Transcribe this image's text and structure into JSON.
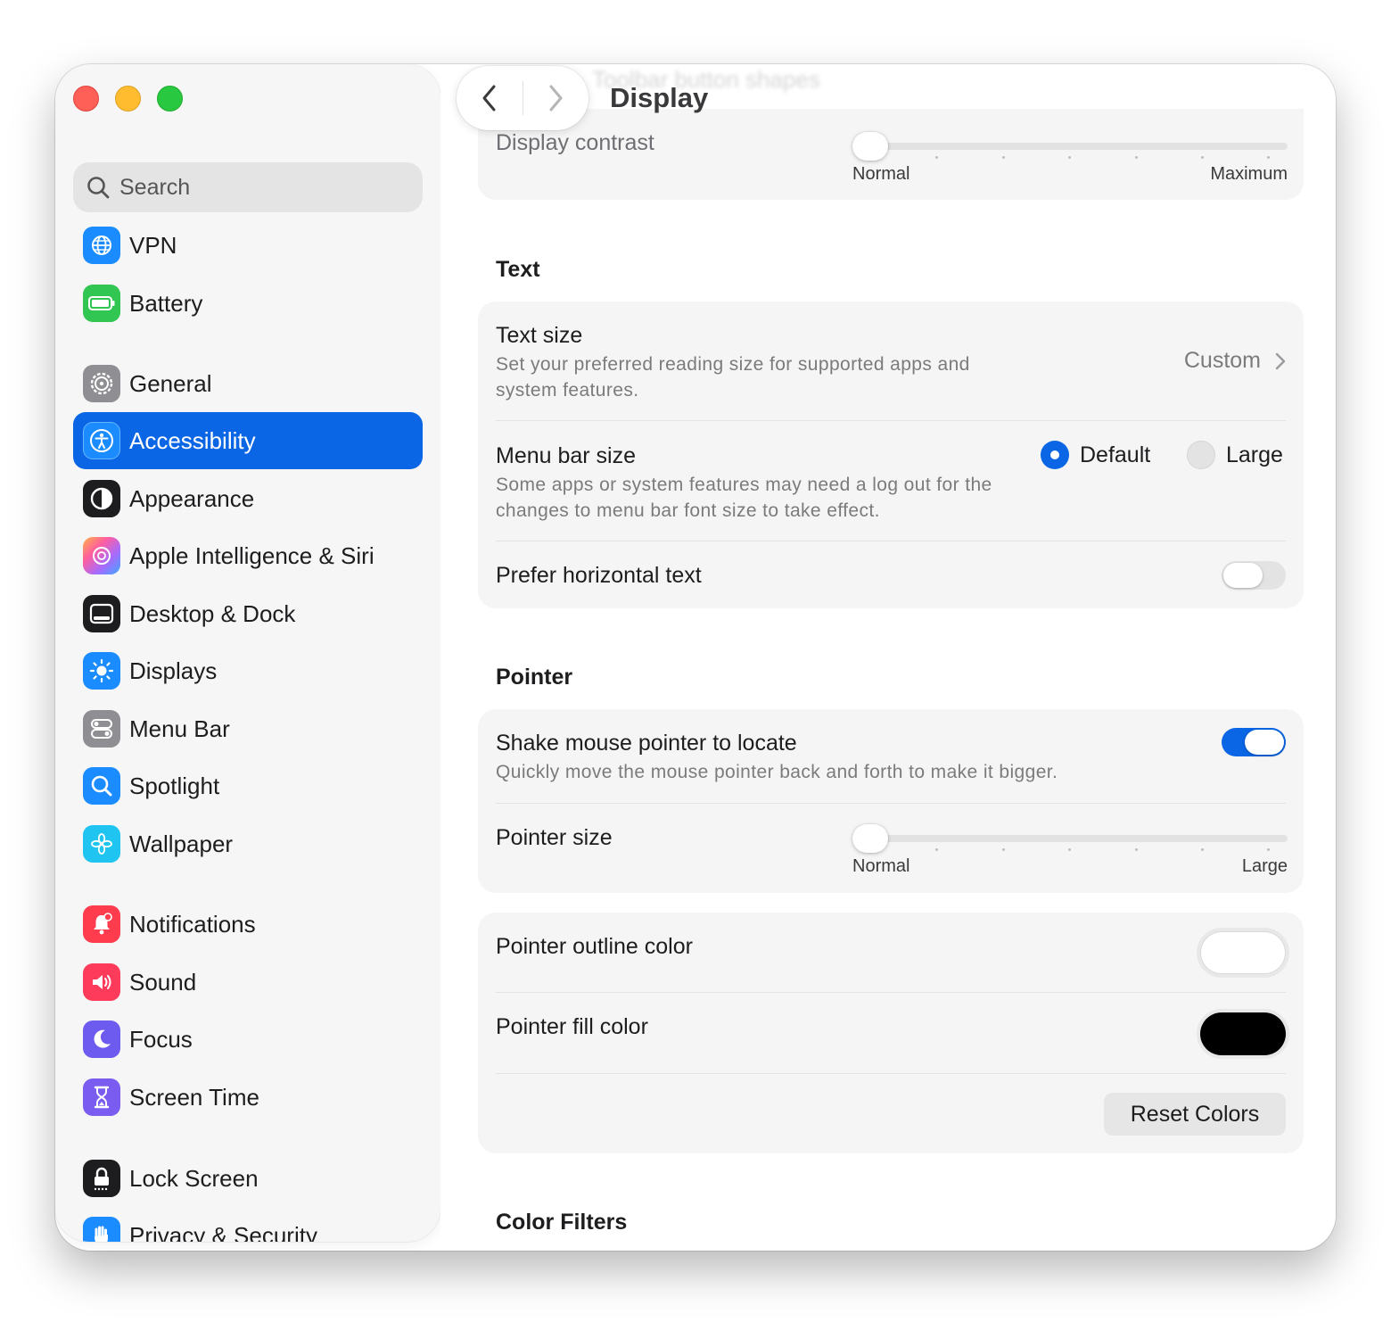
{
  "sidebar": {
    "search_text": "Search",
    "items": [
      {
        "label": "VPN",
        "icon": "vpn-globe-icon",
        "color": "#1a8cff"
      },
      {
        "label": "Battery",
        "icon": "battery-icon",
        "color": "#31c651"
      },
      {
        "label": "General",
        "icon": "gear-icon",
        "color": "#8e8e93"
      },
      {
        "label": "Accessibility",
        "icon": "accessibility-icon",
        "color": "#0a66e4",
        "selected": true
      },
      {
        "label": "Appearance",
        "icon": "appearance-icon",
        "color": "#1d1d1f"
      },
      {
        "label": "Apple Intelligence & Siri",
        "icon": "siri-icon",
        "color": "#ff6aa8"
      },
      {
        "label": "Desktop & Dock",
        "icon": "dock-icon",
        "color": "#1d1d1f"
      },
      {
        "label": "Displays",
        "icon": "sun-icon",
        "color": "#1a8cff"
      },
      {
        "label": "Menu Bar",
        "icon": "menu-bar-icon",
        "color": "#8e8e93"
      },
      {
        "label": "Spotlight",
        "icon": "spotlight-icon",
        "color": "#1a8cff"
      },
      {
        "label": "Wallpaper",
        "icon": "flower-icon",
        "color": "#1fc5f0"
      },
      {
        "label": "Notifications",
        "icon": "bell-icon",
        "color": "#ff3b4e"
      },
      {
        "label": "Sound",
        "icon": "speaker-icon",
        "color": "#ff3b5c"
      },
      {
        "label": "Focus",
        "icon": "moon-icon",
        "color": "#6d5bf0"
      },
      {
        "label": "Screen Time",
        "icon": "hourglass-icon",
        "color": "#7b5cf0"
      },
      {
        "label": "Lock Screen",
        "icon": "lock-icon",
        "color": "#1d1d1f"
      },
      {
        "label": "Privacy & Security",
        "icon": "hand-icon",
        "color": "#1a8cff"
      }
    ]
  },
  "header": {
    "title": "Display",
    "ghost_text": "Toolbar button shapes"
  },
  "display_contrast": {
    "label": "Display contrast",
    "min_label": "Normal",
    "max_label": "Maximum",
    "value": 0
  },
  "text_section": {
    "header": "Text",
    "text_size": {
      "title": "Text size",
      "subtitle": "Set your preferred reading size for supported apps and system features.",
      "value": "Custom"
    },
    "menu_bar_size": {
      "title": "Menu bar size",
      "subtitle": "Some apps or system features may need a log out for the changes to menu bar font size to take effect.",
      "options": [
        "Default",
        "Large"
      ],
      "selected": "Default"
    },
    "prefer_horizontal": {
      "title": "Prefer horizontal text",
      "on": false
    }
  },
  "pointer_section": {
    "header": "Pointer",
    "shake": {
      "title": "Shake mouse pointer to locate",
      "subtitle": "Quickly move the mouse pointer back and forth to make it bigger.",
      "on": true
    },
    "pointer_size": {
      "title": "Pointer size",
      "min_label": "Normal",
      "max_label": "Large",
      "value": 0
    },
    "outline_color": {
      "title": "Pointer outline color",
      "color": "#ffffff"
    },
    "fill_color": {
      "title": "Pointer fill color",
      "color": "#000000"
    },
    "reset_label": "Reset Colors"
  },
  "color_filters": {
    "header": "Color Filters"
  },
  "colors": {
    "accent": "#0a66e4",
    "close": "#fe5f57",
    "minimize": "#febc2e",
    "zoom": "#28c840"
  }
}
